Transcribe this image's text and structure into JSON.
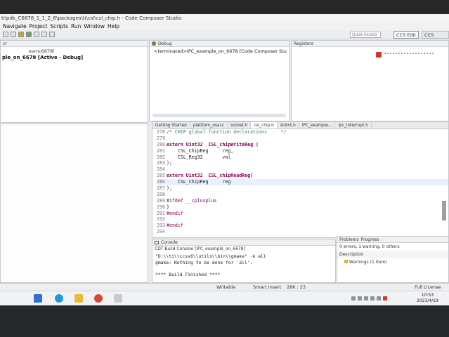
{
  "window_title": "ti\\pdk_C6678_1_1_2_6\\packages\\ti\\csl\\csl_chip.h - Code Composer Studio",
  "menu": [
    "Navigate",
    "Project",
    "Scripts",
    "Run",
    "Window",
    "Help"
  ],
  "toolbar": {
    "quick_access_placeholder": "Quick Access",
    "perspectives": [
      "CCS Edit",
      "CCS Debug"
    ]
  },
  "left_panel": {
    "header": "cr",
    "item_device": "evmc6678l",
    "item_project": "ple_on_6678 [Active - Debug]"
  },
  "debug_view": {
    "title": "Debug",
    "item": "<terminated>IPC_example_on_6678 [Code Composer Stu"
  },
  "registers_view": {
    "title": "Registers"
  },
  "editor": {
    "tabs": [
      "Getting Started",
      "platform_osal.c",
      "socket.h",
      "csl_chip.h",
      "stdint.h",
      "IPC_example...",
      "ipc_interrupt.h"
    ],
    "active_tab": 3,
    "lines": [
      {
        "n": "278",
        "text": "/* CHIP global function declarations     */",
        "cls": "cm"
      },
      {
        "n": "279",
        "text": "",
        "cls": ""
      },
      {
        "n": "280",
        "text": "extern Uint32  CSL_chipWriteReg (",
        "cls": "kw"
      },
      {
        "n": "281",
        "text": "    CSL_ChipReg     reg,",
        "cls": ""
      },
      {
        "n": "282",
        "text": "    CSL_Reg32       val",
        "cls": ""
      },
      {
        "n": "283",
        "text": ");",
        "cls": ""
      },
      {
        "n": "284",
        "text": "",
        "cls": ""
      },
      {
        "n": "285",
        "text": "extern Uint32  CSL_chipReadReg(",
        "cls": "kw"
      },
      {
        "n": "286",
        "text": "    CSL_ChipReg     reg",
        "cls": "hl"
      },
      {
        "n": "287",
        "text": ");",
        "cls": ""
      },
      {
        "n": "288",
        "text": "",
        "cls": ""
      },
      {
        "n": "289",
        "text": "#ifdef __cplusplus",
        "cls": "pp"
      },
      {
        "n": "290",
        "text": "}",
        "cls": ""
      },
      {
        "n": "291",
        "text": "#endif",
        "cls": "pp"
      },
      {
        "n": "292",
        "text": "",
        "cls": ""
      },
      {
        "n": "293",
        "text": "#endif",
        "cls": "pp"
      },
      {
        "n": "294",
        "text": "",
        "cls": ""
      }
    ]
  },
  "console": {
    "title": "Console",
    "subtitle": "CDT Build Console [IPC_example_on_6678]",
    "lines": [
      "\"D:\\\\ti\\\\ccsv6\\\\utils\\\\bin\\\\gmake\" -k all",
      "gmake: Nothing to be done for `all'.",
      "",
      "**** Build Finished ****"
    ]
  },
  "problems": {
    "tabs": [
      "Problems",
      "Progress"
    ],
    "summary": "0 errors, 1 warning, 0 others",
    "column": "Description",
    "item": "Warnings (1 item)"
  },
  "statusbar": {
    "writable": "Writable",
    "insert_mode": "Smart Insert",
    "position": "286 : 23"
  },
  "taskbar": {
    "full_license": "Full License",
    "time": "10:53",
    "date": "2023/4/19"
  }
}
